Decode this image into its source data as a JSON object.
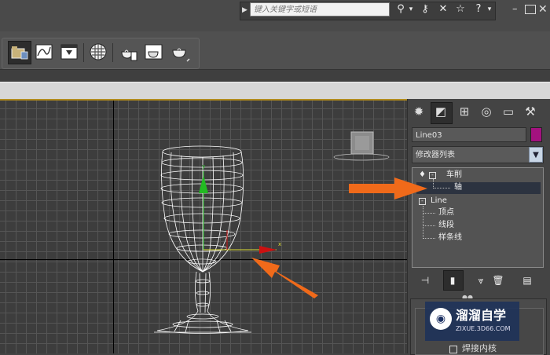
{
  "topbar": {
    "search_placeholder": "键入关键字或短语",
    "icons": [
      "binoculars-icon",
      "key-icon",
      "star-icon",
      "help-icon"
    ],
    "window_controls": [
      "minimize",
      "restore",
      "close"
    ]
  },
  "toolbar": {
    "buttons": [
      "project-folder",
      "curve-editor",
      "render-setup",
      "material-editor",
      "teapot-render",
      "render-frame-window",
      "teapot-quick-render"
    ]
  },
  "command_panel": {
    "tabs": [
      "create",
      "modify",
      "hierarchy",
      "motion",
      "display",
      "utilities"
    ],
    "object_name": "Line03",
    "object_color": "#a3127f",
    "modifier_list_label": "修改器列表",
    "stack": {
      "lathe": "车削",
      "lathe_axis": "轴",
      "line": "Line",
      "sub_items": [
        "顶点",
        "线段",
        "样条线"
      ]
    },
    "rollout_option": "焊接内核"
  },
  "watermark": {
    "title": "溜溜自学",
    "url": "ZIXUE.3D66.COM"
  },
  "colors": {
    "annotation_arrow": "#f06a1a",
    "gizmo_green": "#22bb22",
    "gizmo_red": "#cc1111",
    "viewport_bg": "#3d3d3d"
  }
}
